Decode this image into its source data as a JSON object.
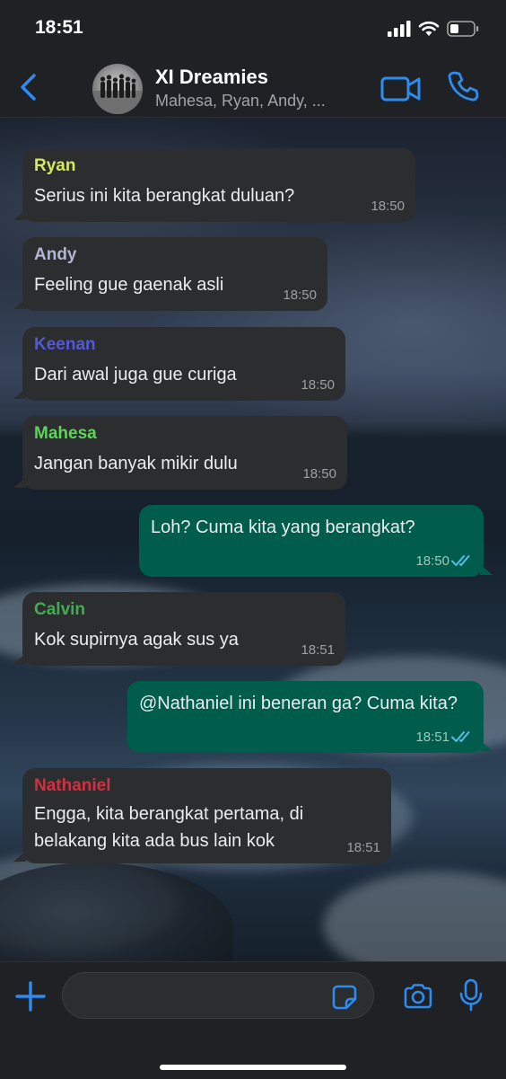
{
  "status_bar": {
    "time": "18:51"
  },
  "header": {
    "title": "XI Dreamies",
    "subtitle": "Mahesa, Ryan, Andy, ..."
  },
  "colors": {
    "accent": "#2d8cf0",
    "incoming_bubble": "#2c2d2f",
    "outgoing_bubble": "#005c4b",
    "read_ticks": "#53bdeb"
  },
  "messages": [
    {
      "direction": "in",
      "sender": "Ryan",
      "sender_color": "#d6e95b",
      "text": "Serius ini kita berangkat duluan?",
      "time": "18:50"
    },
    {
      "direction": "in",
      "sender": "Andy",
      "sender_color": "#b1b6d4",
      "text": "Feeling gue gaenak asli",
      "time": "18:50"
    },
    {
      "direction": "in",
      "sender": "Keenan",
      "sender_color": "#5157e0",
      "text": "Dari awal juga gue curiga",
      "time": "18:50"
    },
    {
      "direction": "in",
      "sender": "Mahesa",
      "sender_color": "#5fd35b",
      "text": "Jangan banyak mikir dulu",
      "time": "18:50"
    },
    {
      "direction": "out",
      "text": "Loh? Cuma kita yang berangkat?",
      "time": "18:50",
      "status": "read"
    },
    {
      "direction": "in",
      "sender": "Calvin",
      "sender_color": "#3fae52",
      "text": "Kok supirnya agak sus ya",
      "time": "18:51"
    },
    {
      "direction": "out",
      "text": "@Nathaniel ini beneran ga? Cuma kita?",
      "time": "18:51",
      "status": "read"
    },
    {
      "direction": "in",
      "sender": "Nathaniel",
      "sender_color": "#d1303e",
      "text": "Engga, kita berangkat pertama, di belakang kita ada bus lain kok",
      "time": "18:51"
    }
  ],
  "composer": {
    "value": "",
    "placeholder": ""
  },
  "icons": {
    "back": "chevron-left-icon",
    "video": "video-camera-icon",
    "call": "phone-icon",
    "attach": "plus-icon",
    "sticker": "sticker-icon",
    "camera": "camera-icon",
    "mic": "microphone-icon"
  }
}
